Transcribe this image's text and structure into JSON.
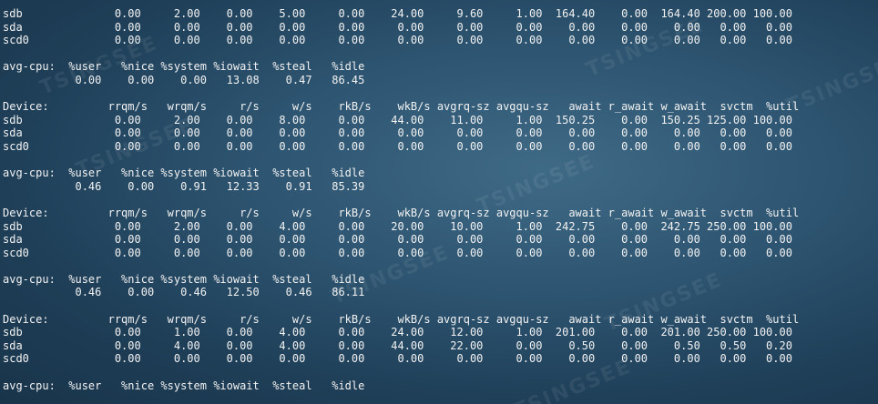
{
  "watermark": "TSINGSEE",
  "terminal_lines": [
    "sdb              0.00     2.00    0.00    5.00     0.00    24.00     9.60     1.00  164.40    0.00  164.40 200.00 100.00",
    "sda              0.00     0.00    0.00    0.00     0.00     0.00     0.00     0.00    0.00    0.00    0.00   0.00   0.00",
    "scd0             0.00     0.00    0.00    0.00     0.00     0.00     0.00     0.00    0.00    0.00    0.00   0.00   0.00",
    "",
    "avg-cpu:  %user   %nice %system %iowait  %steal   %idle",
    "           0.00    0.00    0.00   13.08    0.47   86.45",
    "",
    "Device:         rrqm/s   wrqm/s     r/s     w/s    rkB/s    wkB/s avgrq-sz avgqu-sz   await r_await w_await  svctm  %util",
    "sdb              0.00     2.00    0.00    8.00     0.00    44.00    11.00     1.00  150.25    0.00  150.25 125.00 100.00",
    "sda              0.00     0.00    0.00    0.00     0.00     0.00     0.00     0.00    0.00    0.00    0.00   0.00   0.00",
    "scd0             0.00     0.00    0.00    0.00     0.00     0.00     0.00     0.00    0.00    0.00    0.00   0.00   0.00",
    "",
    "avg-cpu:  %user   %nice %system %iowait  %steal   %idle",
    "           0.46    0.00    0.91   12.33    0.91   85.39",
    "",
    "Device:         rrqm/s   wrqm/s     r/s     w/s    rkB/s    wkB/s avgrq-sz avgqu-sz   await r_await w_await  svctm  %util",
    "sdb              0.00     2.00    0.00    4.00     0.00    20.00    10.00     1.00  242.75    0.00  242.75 250.00 100.00",
    "sda              0.00     0.00    0.00    0.00     0.00     0.00     0.00     0.00    0.00    0.00    0.00   0.00   0.00",
    "scd0             0.00     0.00    0.00    0.00     0.00     0.00     0.00     0.00    0.00    0.00    0.00   0.00   0.00",
    "",
    "avg-cpu:  %user   %nice %system %iowait  %steal   %idle",
    "           0.46    0.00    0.46   12.50    0.46   86.11",
    "",
    "Device:         rrqm/s   wrqm/s     r/s     w/s    rkB/s    wkB/s avgrq-sz avgqu-sz   await r_await w_await  svctm  %util",
    "sdb              0.00     1.00    0.00    4.00     0.00    24.00    12.00     1.00  201.00    0.00  201.00 250.00 100.00",
    "sda              0.00     4.00    0.00    4.00     0.00    44.00    22.00     0.00    0.50    0.00    0.50   0.50   0.20",
    "scd0             0.00     0.00    0.00    0.00     0.00     0.00     0.00     0.00    0.00    0.00    0.00   0.00   0.00",
    "",
    "avg-cpu:  %user   %nice %system %iowait  %steal   %idle"
  ]
}
